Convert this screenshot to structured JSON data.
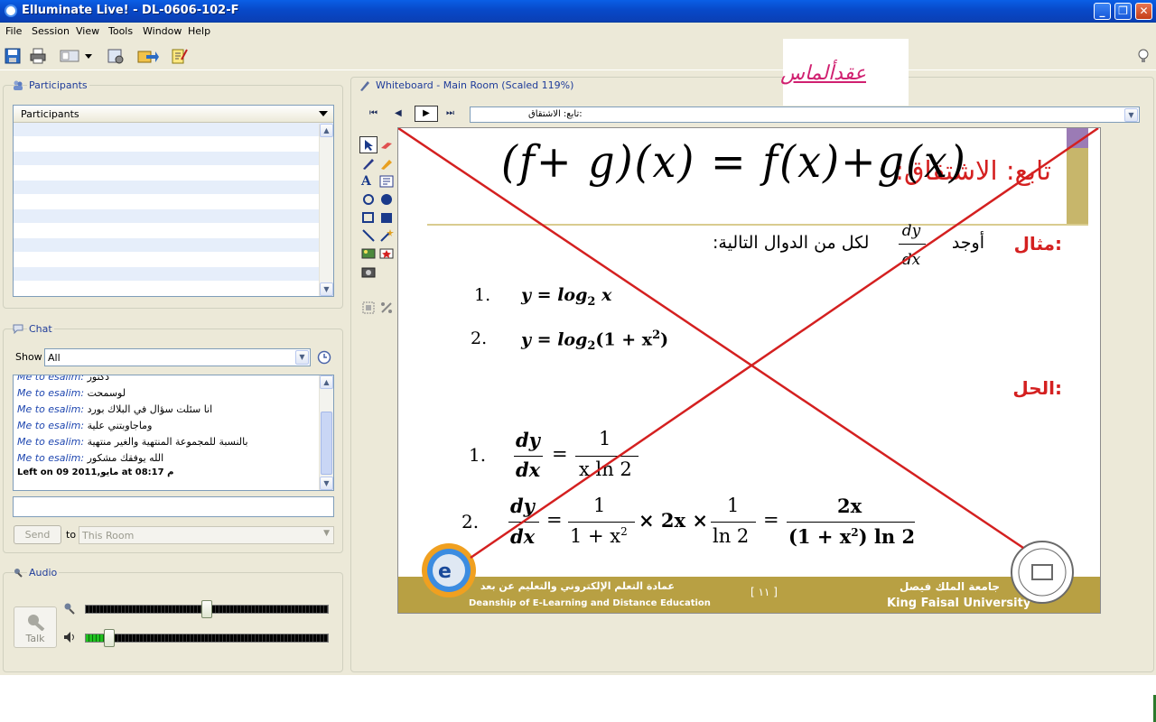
{
  "window": {
    "title": "Elluminate Live! - DL-0606-102-F"
  },
  "menu": [
    "File",
    "Session",
    "View",
    "Tools",
    "Window",
    "Help"
  ],
  "overlay": {
    "text": "عقدألماس"
  },
  "participants": {
    "title": "Participants",
    "header": "Participants"
  },
  "chat": {
    "title": "Chat",
    "show_label": "Show",
    "show_value": "All",
    "messages": [
      {
        "from": "Me to esalim:",
        "text": "دكتور"
      },
      {
        "from": "Me to esalim:",
        "text": "لوسمحت"
      },
      {
        "from": "Me to esalim:",
        "text": "انا سئلت سؤال في البلاك بورد"
      },
      {
        "from": "Me to esalim:",
        "text": "وماجاوبتني علية"
      },
      {
        "from": "Me to esalim:",
        "text": "بالنسبة للمجموعة المنتهية والغير منتهية"
      },
      {
        "from": "Me to esalim:",
        "text": "الله يوفقك مشكور"
      }
    ],
    "status": "Left on 09 مايو,2011  at 08:17 م",
    "send_label": "Send",
    "to_label": "to",
    "to_value": "This Room"
  },
  "audio": {
    "title": "Audio",
    "talk_label": "Talk",
    "mic_level": 0.5,
    "speaker_level": 0.08
  },
  "whiteboard": {
    "title": "Whiteboard - Main Room (Scaled 119%)",
    "page_value": "تابع: الاشتقاق:",
    "slide": {
      "heading": "تابع: الاشتقاق:",
      "handwriting": "(f+ g)(x) = f(x)+g(x)",
      "example_label": "مثال:",
      "example_text_a": "أوجد",
      "example_text_b": "لكل من الدوال التالية:",
      "dy": "dy",
      "dx": "dx",
      "p1_num": "1.",
      "p1": "y = log",
      "p1_sub": "2",
      "p1_x": "x",
      "p2_num": "2.",
      "p2": "y = log",
      "p2_sub": "2",
      "p2_rest": "(1 + x",
      "p2_sup": "2",
      "p2_close": ")",
      "solution_label": "الحل:",
      "s1_num": "1.",
      "s1_one": "1",
      "s1_den": "x ln 2",
      "s2_num": "2.",
      "s2_one_a": "1",
      "s2_den_a": "1 + x",
      "s2_mul": "× 2x ×",
      "s2_one_b": "1",
      "s2_den_b": "ln 2",
      "s2_num_c": "2x",
      "s2_den_c": "(1 + x",
      "s2_den_c2": ") ln 2",
      "sup2": "2",
      "eq": "=",
      "footer_left_ar": "عمادة التعلم الإلكتروني والتعليم عن بعد",
      "footer_left_en": "Deanship of E-Learning and Distance Education",
      "footer_page": "[ ١١ ]",
      "footer_right_ar": "جامعة الملك فيصل",
      "footer_right_en": "King Faisal University"
    }
  },
  "colors": {
    "accent_red": "#d42020",
    "footer_gold": "#b8a043",
    "title_blue": "#0a4fd6"
  }
}
